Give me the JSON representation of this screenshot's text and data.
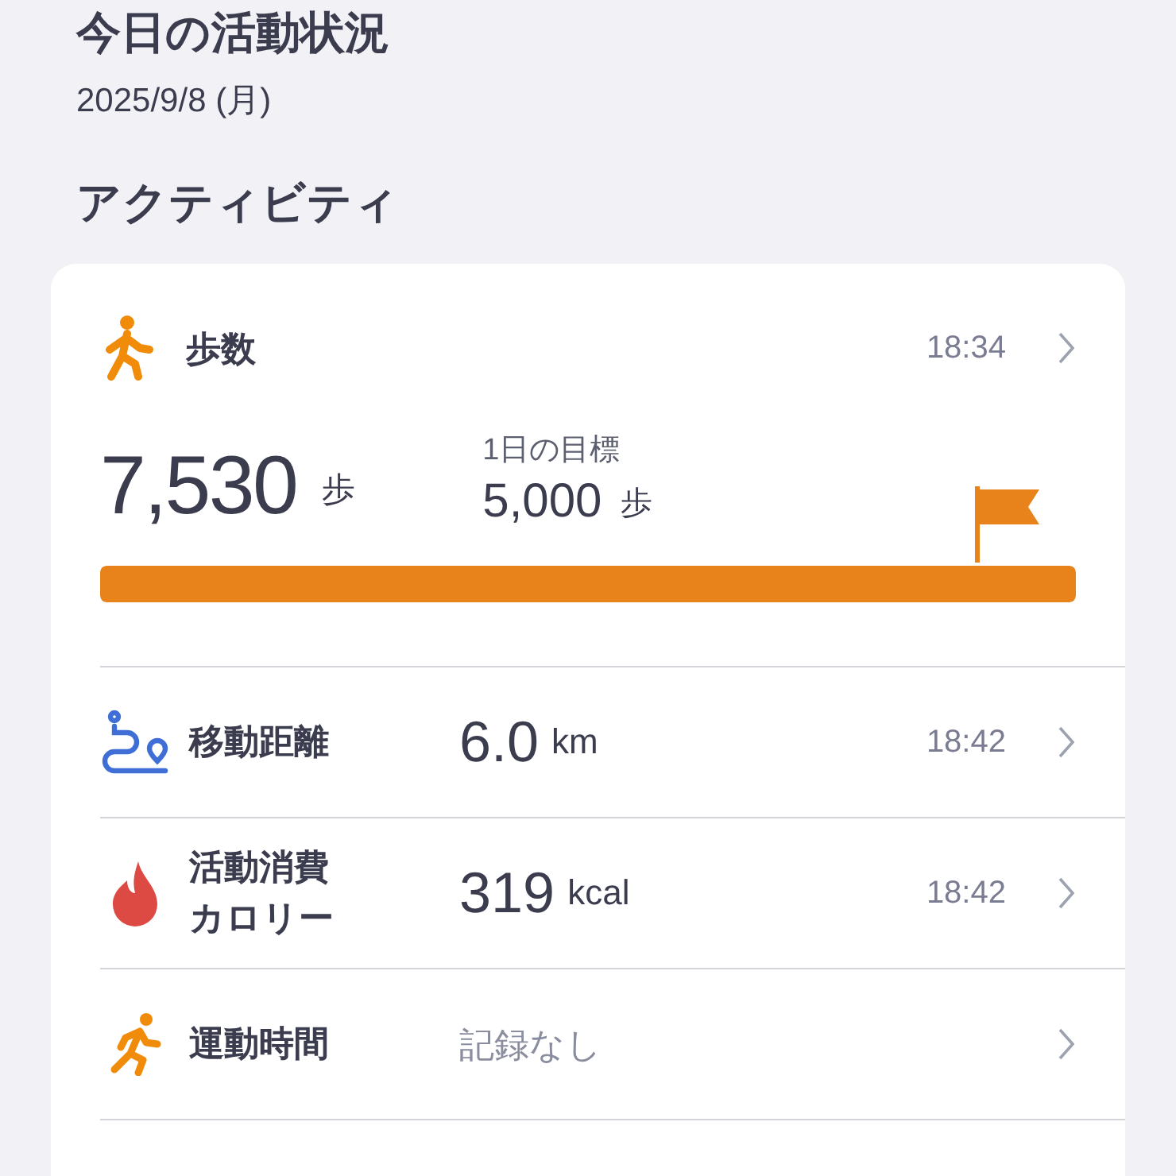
{
  "title": "今日の活動状況",
  "date": "2025/9/8 (月)",
  "section": "アクティビティ",
  "steps": {
    "label": "歩数",
    "time": "18:34",
    "value": "7,530",
    "unit": "歩",
    "goal_label": "1日の目標",
    "goal_value": "5,000",
    "goal_unit": "歩",
    "level": 1
  },
  "rows": [
    {
      "kind": "distance",
      "label": "移動距離",
      "value": "6.0",
      "unit": "km",
      "time": "18:42"
    },
    {
      "kind": "calories",
      "label": "活動消費カロリー",
      "value": "319",
      "unit": "kcal",
      "time": "18:42"
    },
    {
      "kind": "exercise",
      "label": "運動時間",
      "empty_text": "記録なし"
    }
  ]
}
